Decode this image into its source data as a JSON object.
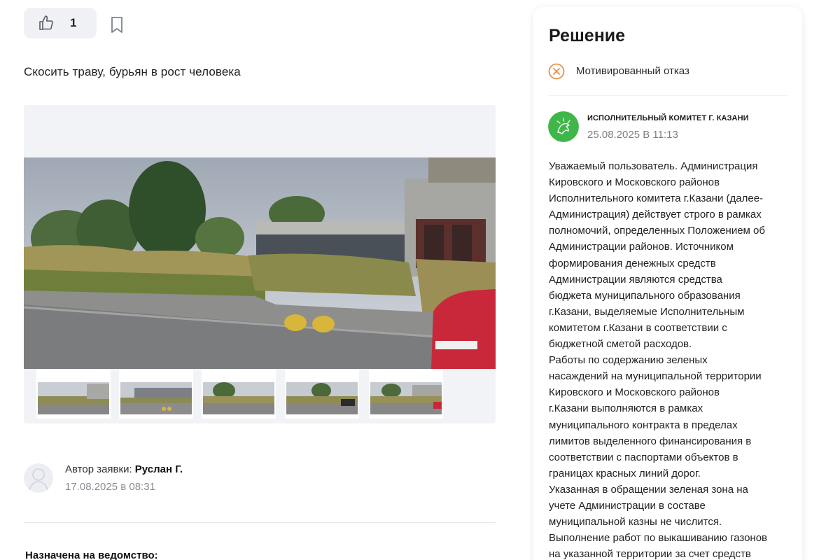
{
  "reactions": {
    "like_count": "1"
  },
  "issue": {
    "title": "Скосить траву, бурьян в рост человека"
  },
  "gallery": {
    "thumbnail_count": 5
  },
  "author": {
    "label": "Автор заявки:",
    "name": "Руслан Г.",
    "date": "17.08.2025 в 08:31"
  },
  "assignment": {
    "label": "Назначена на ведомство:"
  },
  "decision": {
    "title": "Решение",
    "status": "Мотивированный отказ",
    "status_color": "#e8914b",
    "organization": "ИСПОЛНИТЕЛЬНЫЙ КОМИТЕТ Г. КАЗАНИ",
    "date": "25.08.2025 В 11:13",
    "logo_color": "#3fb54a",
    "text": "Уважаемый пользователь. Администрация\nКировского и Московского районов\nИсполнительного комитета г.Казани (далее-\nАдминистрация) действует строго в рамках\nполномочий, определенных Положением об\nАдминистрации районов. Источником\nформирования денежных средств\nАдминистрации являются средства\nбюджета муниципального образования\nг.Казани, выделяемые Исполнительным\nкомитетом г.Казани в соответствии с\nбюджетной сметой расходов.\nРаботы по содержанию зеленых\nнасаждений на муниципальной территории\nКировского и Московского районов\nг.Казани выполняются в рамках\nмуниципального контракта в пределах\nлимитов выделенного финансирования в\nсоответствии с паспортами объектов в\nграницах красных линий дорог.\nУказанная в обращении зеленая зона на\nучете Администрации в составе\nмуниципальной казны не числится.\nВыполнение работ по выкашиванию газонов\nна указанной территории за счет средств"
  }
}
